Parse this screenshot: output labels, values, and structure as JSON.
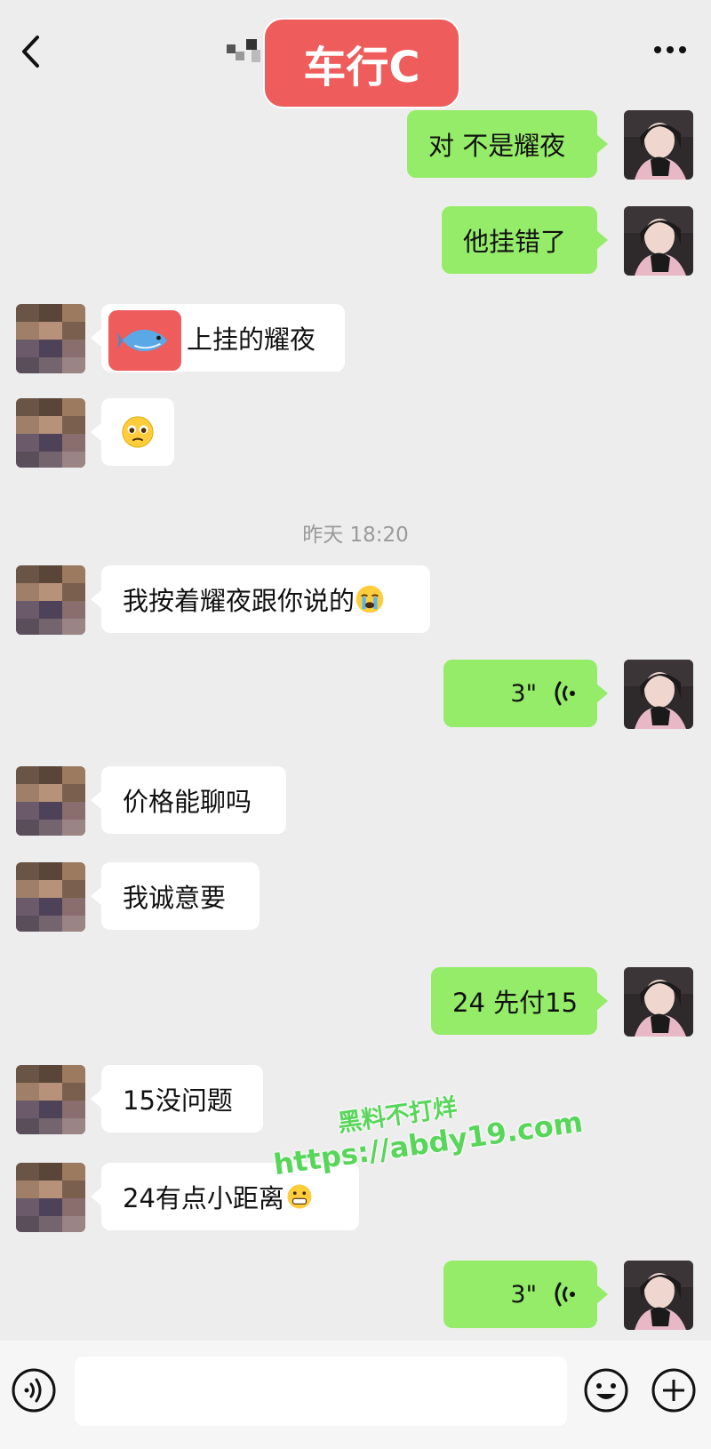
{
  "header": {
    "title": "车行C"
  },
  "timestamp": "昨天 18:20",
  "messages": [
    {
      "side": "out",
      "text": "对 不是耀夜"
    },
    {
      "side": "out",
      "text": "他挂错了"
    },
    {
      "side": "in",
      "text": "上挂的耀夜",
      "emoji": "fish"
    },
    {
      "side": "in",
      "text": "",
      "emoji": "pleading-face"
    },
    {
      "side": "in",
      "text": "我按着耀夜跟你说的",
      "emoji": "crying-face"
    },
    {
      "side": "out",
      "voice": "3\""
    },
    {
      "side": "in",
      "text": "价格能聊吗"
    },
    {
      "side": "in",
      "text": "我诚意要"
    },
    {
      "side": "out",
      "text": "24 先付15"
    },
    {
      "side": "in",
      "text": "15没问题"
    },
    {
      "side": "in",
      "text": "24有点小距离",
      "emoji": "grimace-face"
    },
    {
      "side": "out",
      "voice": "3\""
    }
  ],
  "watermark": {
    "line1": "黑料不打烊",
    "line2": "https://abdy19.com"
  },
  "colors": {
    "background": "#ededed",
    "outgoing_bubble": "#95ec69",
    "incoming_bubble": "#ffffff",
    "title_badge": "#ee5c5c",
    "watermark": "#58d65a"
  },
  "icons": [
    "back-icon",
    "more-icon",
    "voice-icon",
    "voice-toggle-icon",
    "emoji-button-icon",
    "plus-button-icon"
  ]
}
